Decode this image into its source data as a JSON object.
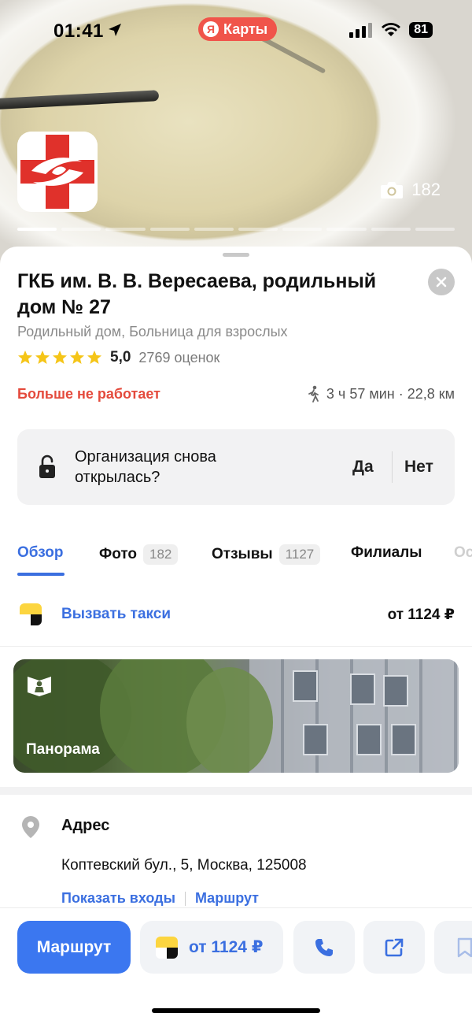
{
  "status_bar": {
    "time": "01:41",
    "app_pill": "Карты",
    "app_pill_logo": "Я",
    "battery": "81"
  },
  "photo": {
    "count": "182",
    "pages": 10,
    "active_page": 1
  },
  "place": {
    "title": "ГКБ им. В. В. Вересаева, родильный дом № 27",
    "category": "Родильный дом, Больница для взрослых",
    "rating": "5,0",
    "rating_count": "2769 оценок",
    "stars": 5,
    "status": "Больше не работает",
    "walk_time": "3 ч 57 мин · 22,8 км"
  },
  "reopen": {
    "question": "Организация снова открылась?",
    "yes": "Да",
    "no": "Нет"
  },
  "tabs": [
    {
      "label": "Обзор",
      "count": ""
    },
    {
      "label": "Фото",
      "count": "182"
    },
    {
      "label": "Отзывы",
      "count": "1127"
    },
    {
      "label": "Филиалы",
      "count": ""
    },
    {
      "label": "Ос",
      "count": ""
    }
  ],
  "taxi": {
    "label": "Вызвать такси",
    "price": "от 1124 ₽"
  },
  "panorama": {
    "label": "Панорама"
  },
  "address": {
    "title": "Адрес",
    "text": "Коптевский бул., 5, Москва, 125008",
    "show_entrances": "Показать входы",
    "route": "Маршрут"
  },
  "bottom_bar": {
    "route": "Маршрут",
    "taxi_price": "от 1124 ₽"
  },
  "colors": {
    "accent": "#3b77f0",
    "closed_red": "#e44a3c",
    "star": "#f5c518",
    "logo_red": "#e0312b"
  }
}
